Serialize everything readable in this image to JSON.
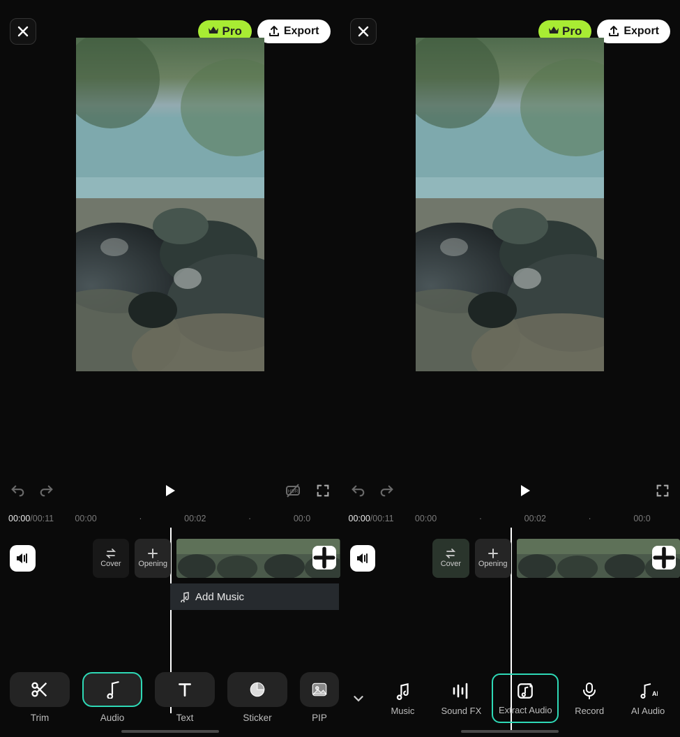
{
  "colors": {
    "accent": "#2ed9b6",
    "pro": "#a8ec33"
  },
  "left": {
    "pro_label": "Pro",
    "export_label": "Export",
    "time_current": "00:00",
    "time_total": "/00:11",
    "ruler": {
      "t0": "00:00",
      "dot0": "·",
      "t1": "00:02",
      "dot1": "·",
      "t2": "00:0"
    },
    "cover_label": "Cover",
    "opening_label": "Opening",
    "add_music_label": "Add Music",
    "tools": {
      "trim": "Trim",
      "audio": "Audio",
      "text": "Text",
      "sticker": "Sticker",
      "pip": "PIP"
    }
  },
  "right": {
    "pro_label": "Pro",
    "export_label": "Export",
    "time_current": "00:00",
    "time_total": "/00:11",
    "ruler": {
      "t0": "00:00",
      "dot0": "·",
      "t1": "00:02",
      "dot1": "·",
      "t2": "00:0"
    },
    "cover_label": "Cover",
    "opening_label": "Opening",
    "tools": {
      "music": "Music",
      "soundfx": "Sound FX",
      "extract": "Extract Audio",
      "record": "Record",
      "aiaudio": "AI Audio"
    }
  }
}
